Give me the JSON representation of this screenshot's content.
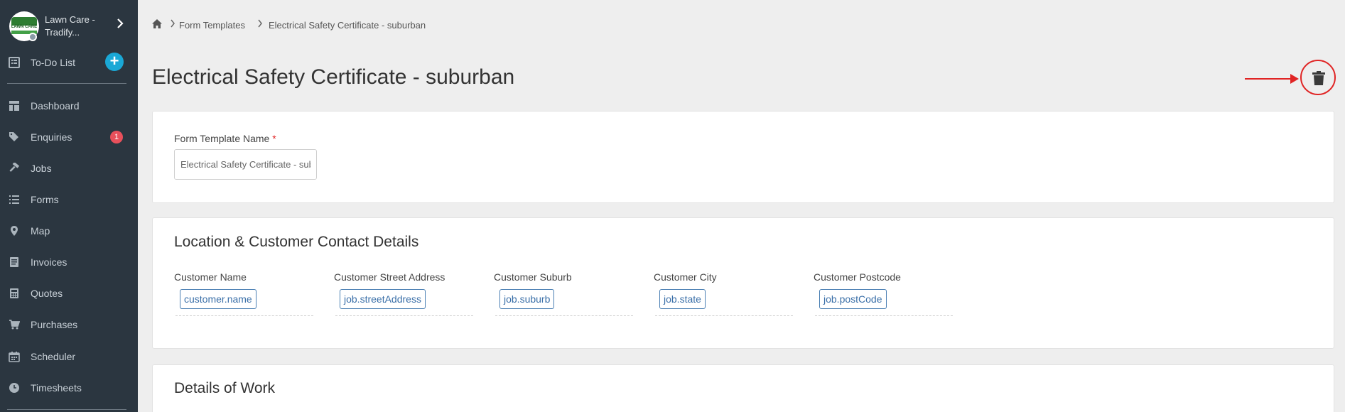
{
  "sidebar": {
    "brand_name": "Lawn Care - Tradify...",
    "logo_text": "LAWN CARE",
    "todo": "To-Do List",
    "items": [
      {
        "label": "Dashboard",
        "icon": "dashboard-icon"
      },
      {
        "label": "Enquiries",
        "icon": "tags-icon"
      },
      {
        "label": "Jobs",
        "icon": "hammer-icon"
      },
      {
        "label": "Forms",
        "icon": "list-icon"
      },
      {
        "label": "Map",
        "icon": "map-pin-icon"
      },
      {
        "label": "Invoices",
        "icon": "invoice-icon"
      },
      {
        "label": "Quotes",
        "icon": "calculator-icon"
      },
      {
        "label": "Purchases",
        "icon": "cart-icon"
      },
      {
        "label": "Scheduler",
        "icon": "calendar-icon"
      },
      {
        "label": "Timesheets",
        "icon": "clock-icon"
      }
    ],
    "enquiries_badge": "1",
    "plus": "+"
  },
  "breadcrumb": {
    "items": [
      "Form Templates",
      "Electrical Safety Certificate - suburban"
    ]
  },
  "page": {
    "title": "Electrical Safety Certificate - suburban"
  },
  "form": {
    "name_label": "Form Template Name",
    "required_mark": "*",
    "name_value": "Electrical Safety Certificate - suburban"
  },
  "location_section": {
    "title": "Location & Customer Contact Details",
    "fields": [
      {
        "label": "Customer Name",
        "tag": "customer.name"
      },
      {
        "label": "Customer Street Address",
        "tag": "job.streetAddress"
      },
      {
        "label": "Customer Suburb",
        "tag": "job.suburb"
      },
      {
        "label": "Customer City",
        "tag": "job.state"
      },
      {
        "label": "Customer Postcode",
        "tag": "job.postCode"
      }
    ]
  },
  "details_section": {
    "title": "Details of Work"
  },
  "colors": {
    "sidebar_bg": "#2b3640",
    "accent": "#1aa8d6",
    "badge": "#e8505b",
    "annotation": "#e02424",
    "tag": "#3a6fa8"
  }
}
